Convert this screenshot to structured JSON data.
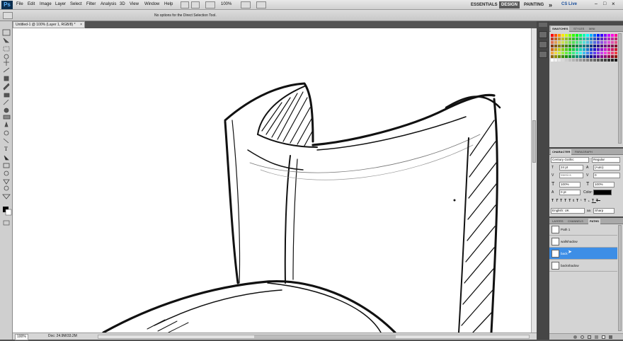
{
  "menubar": {
    "logo": "Ps",
    "items": [
      "File",
      "Edit",
      "Image",
      "Layer",
      "Select",
      "Filter",
      "Analysis",
      "3D",
      "View",
      "Window",
      "Help"
    ],
    "zoom": "100%",
    "workspaces": [
      "ESSENTIALS",
      "DESIGN",
      "PAINTING"
    ],
    "active_workspace": "DESIGN",
    "more": "»",
    "cs_live": "CS Live"
  },
  "options_bar": {
    "hint": "No options for the Direct Selection Tool."
  },
  "document": {
    "tab_title": "Untitled-1 @ 100% (Layer 1, RGB/8) *",
    "zoom": "100%",
    "doc_info": "Doc: 24.9M/33.2M"
  },
  "swatches_panel": {
    "tabs": [
      "SWATCHES",
      "STYLES",
      "MINI"
    ]
  },
  "character_panel": {
    "tabs": [
      "CHARACTER",
      "PARAGRAPH"
    ],
    "font_family": "Century Gothic",
    "font_style": "Regular",
    "font_size": "24 pt",
    "leading": "(Auto)",
    "kerning": "Metrics",
    "tracking": "0",
    "vertical_scale": "100%",
    "horizontal_scale": "100%",
    "baseline_shift": "0 pt",
    "color_label": "Color:",
    "language": "English: UK",
    "antialias": "Sharp",
    "text_color": "#000000"
  },
  "layers_panel": {
    "tabs": [
      "LAYERS",
      "CHANNELS",
      "PATHS"
    ],
    "active_tab": "PATHS",
    "paths": [
      {
        "name": "Path 1",
        "selected": false
      },
      {
        "name": "wallshadow",
        "selected": false
      },
      {
        "name": "back",
        "selected": true
      },
      {
        "name": "backshadow",
        "selected": false
      }
    ]
  },
  "colors": {
    "accent": "#3d8ee6",
    "panel_bg": "#d4d4d4",
    "app_bg": "#535353"
  }
}
